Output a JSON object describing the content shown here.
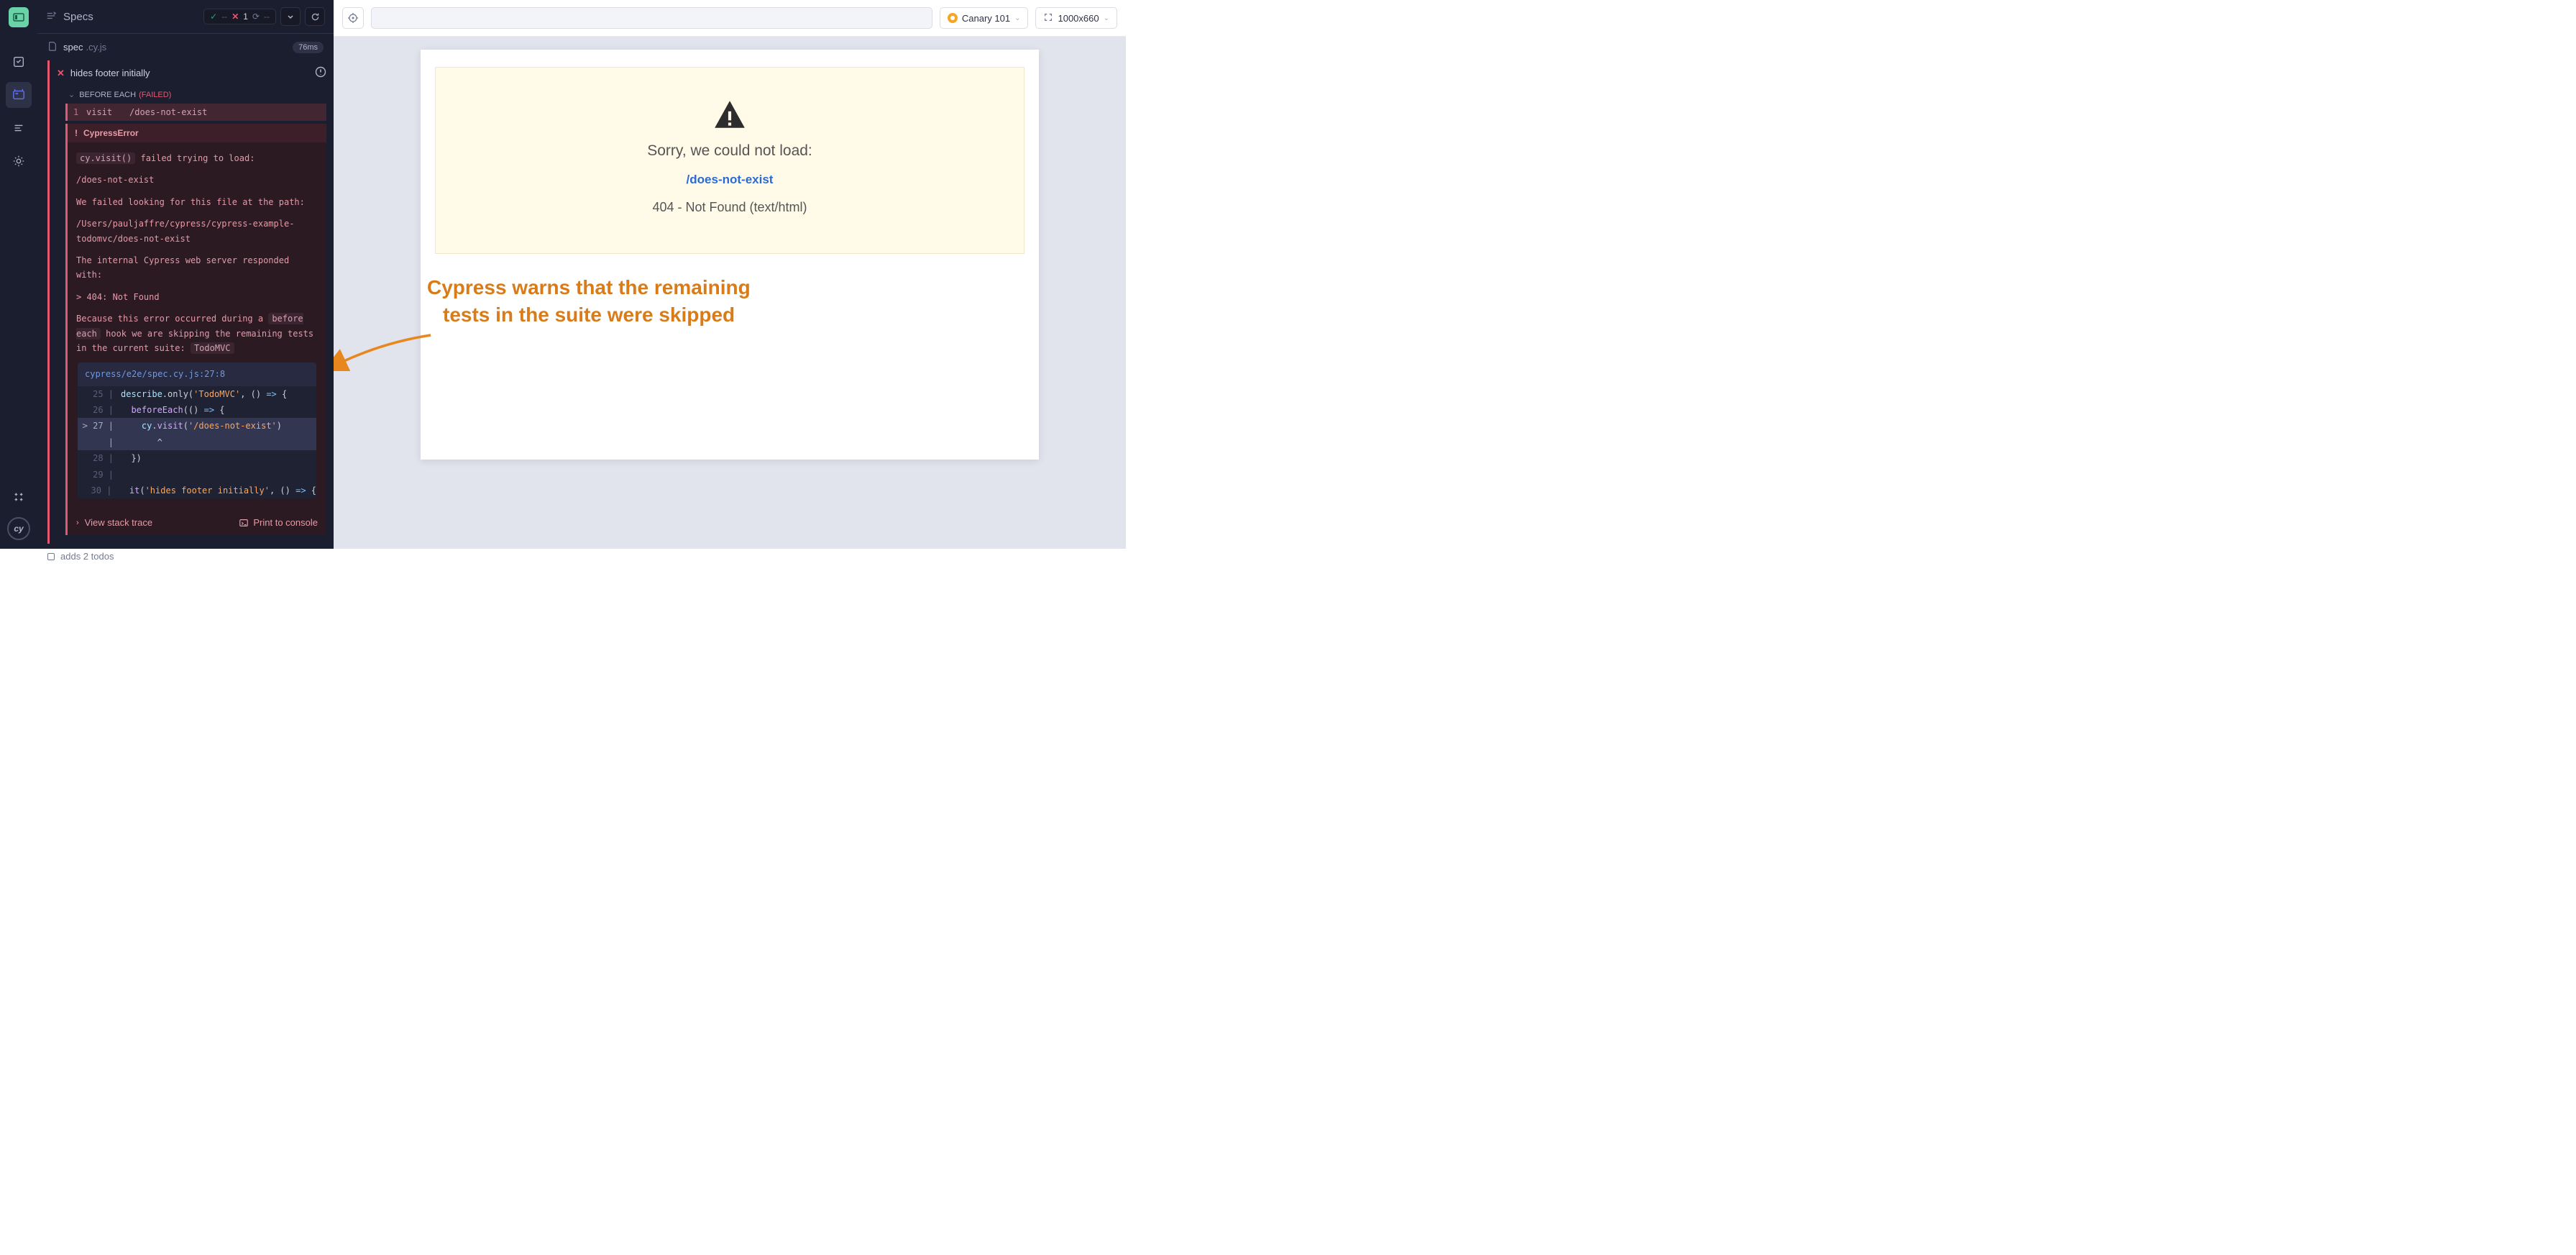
{
  "nav": {
    "cy": "cy"
  },
  "header": {
    "title": "Specs",
    "pass_dash": "--",
    "fail_count": "1",
    "pending_dash": "--"
  },
  "spec": {
    "name": "spec",
    "ext": ".cy.js",
    "duration": "76ms"
  },
  "test": {
    "title": "hides footer initially",
    "hook_label": "BEFORE EACH",
    "hook_status": "(FAILED)",
    "cmd_num": "1",
    "cmd_name": "visit",
    "cmd_arg": "/does-not-exist"
  },
  "error": {
    "name": "CypressError",
    "l1a": "cy.visit()",
    "l1b": " failed trying to load:",
    "l2": "/does-not-exist",
    "l3": "We failed looking for this file at the path:",
    "l4": "/Users/pauljaffre/cypress/cypress-example-todomvc/does-not-exist",
    "l5": "The internal Cypress web server responded with:",
    "l6": "  > 404: Not Found",
    "l7a": "Because this error occurred during a ",
    "l7b": "before each",
    "l7c": " hook we are skipping the remaining tests in the current suite: ",
    "l7d": "TodoMVC"
  },
  "codeframe": {
    "file": "cypress/e2e/spec.cy.js:27:8",
    "lines": [
      {
        "num": "25",
        "marker": "  ",
        "hl": false,
        "tokens": [
          [
            "id",
            "describe"
          ],
          [
            "punc",
            ".only("
          ],
          [
            "str",
            "'TodoMVC'"
          ],
          [
            "punc",
            ", () "
          ],
          [
            "kw",
            "=>"
          ],
          [
            "punc",
            " {"
          ]
        ]
      },
      {
        "num": "26",
        "marker": "  ",
        "hl": false,
        "tokens": [
          [
            "punc",
            "  "
          ],
          [
            "fn",
            "beforeEach"
          ],
          [
            "punc",
            "(() "
          ],
          [
            "kw",
            "=>"
          ],
          [
            "punc",
            " {"
          ]
        ]
      },
      {
        "num": "27",
        "marker": "> ",
        "hl": true,
        "tokens": [
          [
            "punc",
            "    "
          ],
          [
            "id",
            "cy"
          ],
          [
            "punc",
            "."
          ],
          [
            "fn",
            "visit"
          ],
          [
            "punc",
            "("
          ],
          [
            "str",
            "'/does-not-exist'"
          ],
          [
            "punc",
            ")"
          ]
        ]
      },
      {
        "num": "",
        "marker": "  ",
        "hl": true,
        "caret": true,
        "tokens": [
          [
            "punc",
            "       ^"
          ]
        ]
      },
      {
        "num": "28",
        "marker": "  ",
        "hl": false,
        "tokens": [
          [
            "punc",
            "  })"
          ]
        ]
      },
      {
        "num": "29",
        "marker": "  ",
        "hl": false,
        "tokens": [
          [
            "punc",
            ""
          ]
        ]
      },
      {
        "num": "30",
        "marker": "  ",
        "hl": false,
        "tokens": [
          [
            "punc",
            "  "
          ],
          [
            "fn",
            "it"
          ],
          [
            "punc",
            "("
          ],
          [
            "str",
            "'hides footer initially'"
          ],
          [
            "punc",
            ", () "
          ],
          [
            "kw",
            "=>"
          ],
          [
            "punc",
            " {"
          ]
        ]
      }
    ]
  },
  "footer": {
    "stack": "View stack trace",
    "print": "Print to console"
  },
  "skipped": {
    "label": "adds 2 todos"
  },
  "aut_toolbar": {
    "browser": "Canary 101",
    "viewport": "1000x660"
  },
  "aut_error": {
    "title": "Sorry, we could not load:",
    "path": "/does-not-exist",
    "status": "404 - Not Found (text/html)"
  },
  "annotation": {
    "l1": "Cypress warns that the remaining",
    "l2": "tests in the suite were skipped"
  }
}
